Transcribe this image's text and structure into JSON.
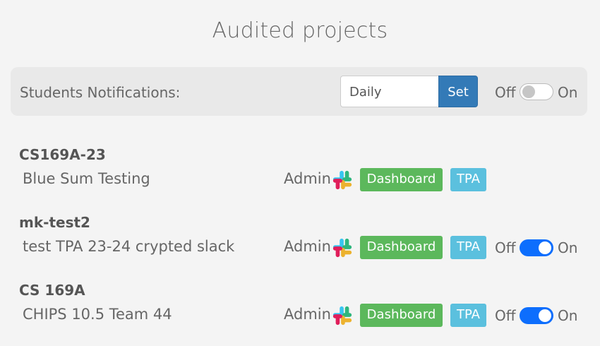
{
  "page": {
    "title": "Audited projects"
  },
  "notifications": {
    "label": "Students  Notifications:",
    "frequency": "Daily",
    "set_label": "Set",
    "off_label": "Off",
    "on_label": "On",
    "enabled": false
  },
  "projects": [
    {
      "name": "CS169A-23",
      "description": "Blue Sum Testing",
      "admin_label": "Admin",
      "icon": "slack-icon",
      "dashboard_label": "Dashboard",
      "tpa_label": "TPA",
      "has_toggle": false
    },
    {
      "name": "mk-test2",
      "description": "test TPA 23-24 crypted slack",
      "admin_label": "Admin",
      "icon": "slack-icon",
      "dashboard_label": "Dashboard",
      "tpa_label": "TPA",
      "has_toggle": true,
      "toggle_off_label": "Off",
      "toggle_on_label": "On",
      "enabled": true
    },
    {
      "name": "CS 169A",
      "description": "CHIPS 10.5 Team 44",
      "admin_label": "Admin",
      "icon": "slack-icon",
      "dashboard_label": "Dashboard",
      "tpa_label": "TPA",
      "has_toggle": true,
      "toggle_off_label": "Off",
      "toggle_on_label": "On",
      "enabled": true
    }
  ],
  "colors": {
    "primary": "#337ab7",
    "success": "#5cb85c",
    "info": "#5bc0de",
    "toggle_on": "#0d6efd"
  }
}
